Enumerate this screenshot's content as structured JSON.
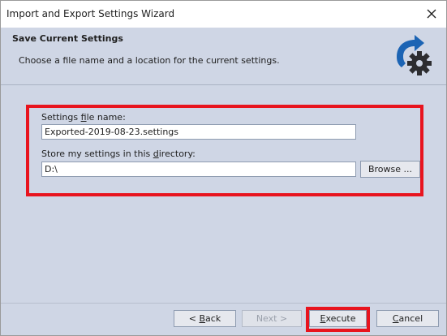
{
  "window": {
    "title": "Import and Export Settings Wizard",
    "close_icon": "close-icon"
  },
  "header": {
    "title": "Save Current Settings",
    "subtitle": "Choose a file name and a location for the current settings.",
    "icon": "export-settings-gear-icon",
    "icon_colors": {
      "arrow": "#1c64b4",
      "gear": "#2d2d30"
    }
  },
  "form": {
    "file_name_label_pre": "Settings ",
    "file_name_label_accel": "f",
    "file_name_label_post": "ile name:",
    "file_name_value": "Exported-2019-08-23.settings",
    "directory_label_pre": "Store my settings in this ",
    "directory_label_accel": "d",
    "directory_label_post": "irectory:",
    "directory_value": "D:\\",
    "browse_label": "Browse ..."
  },
  "footer": {
    "back_accel": "B",
    "back_pre": "< ",
    "back_post": "ack",
    "next_label": "Next >",
    "execute_accel": "E",
    "execute_post": "xecute",
    "cancel_accel": "C",
    "cancel_post": "ancel"
  },
  "colors": {
    "highlight": "#e8141e",
    "panel": "#cfd6e5"
  }
}
